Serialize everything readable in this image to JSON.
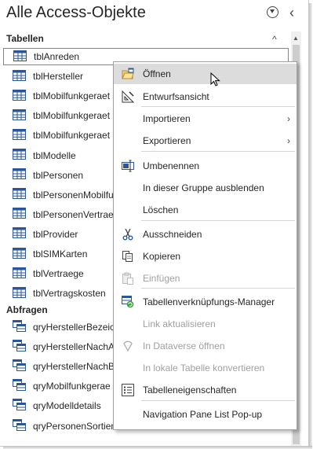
{
  "pane": {
    "title": "Alle Access-Objekte",
    "groups": [
      {
        "label": "Tabellen"
      },
      {
        "label": "Abfragen"
      }
    ]
  },
  "tables": [
    "tblAnreden",
    "tblHersteller",
    "tblMobilfunkgeraet",
    "tblMobilfunkgeraet",
    "tblMobilfunkgeraet",
    "tblModelle",
    "tblPersonen",
    "tblPersonenMobilfu",
    "tblPersonenVertrae",
    "tblProvider",
    "tblSIMKarten",
    "tblVertraege",
    "tblVertragskosten"
  ],
  "queries": [
    "qryHerstellerBezeic",
    "qryHerstellerNachA",
    "qryHerstellerNachB",
    "qryMobilfunkgerae",
    "qryModelldetails",
    "qryPersonenSortien"
  ],
  "menu": [
    {
      "label": "Öffnen",
      "icon": "open-icon",
      "state": "hover"
    },
    {
      "label": "Entwurfsansicht",
      "icon": "design-view-icon"
    },
    {
      "label": "Importieren",
      "submenu": true
    },
    {
      "label": "Exportieren",
      "submenu": true
    },
    {
      "label": "Umbenennen",
      "icon": "rename-icon"
    },
    {
      "label": "In dieser Gruppe ausblenden"
    },
    {
      "label": "Löschen"
    },
    {
      "label": "Ausschneiden",
      "icon": "cut-icon"
    },
    {
      "label": "Kopieren",
      "icon": "copy-icon"
    },
    {
      "label": "Einfügen",
      "icon": "paste-icon",
      "disabled": true
    },
    {
      "label": "Tabellenverknüpfungs-Manager",
      "icon": "linked-table-manager-icon"
    },
    {
      "label": "Link aktualisieren",
      "disabled": true
    },
    {
      "label": "In Dataverse öffnen",
      "icon": "dataverse-icon",
      "disabled": true
    },
    {
      "label": "In lokale Tabelle konvertieren",
      "disabled": true
    },
    {
      "label": "Tabelleneigenschaften",
      "icon": "table-properties-icon"
    },
    {
      "label": "Navigation Pane List Pop-up"
    }
  ],
  "colors": {
    "accent": "#2b579a",
    "hover": "#dcdcdc",
    "disabled": "#a0a0a0"
  }
}
